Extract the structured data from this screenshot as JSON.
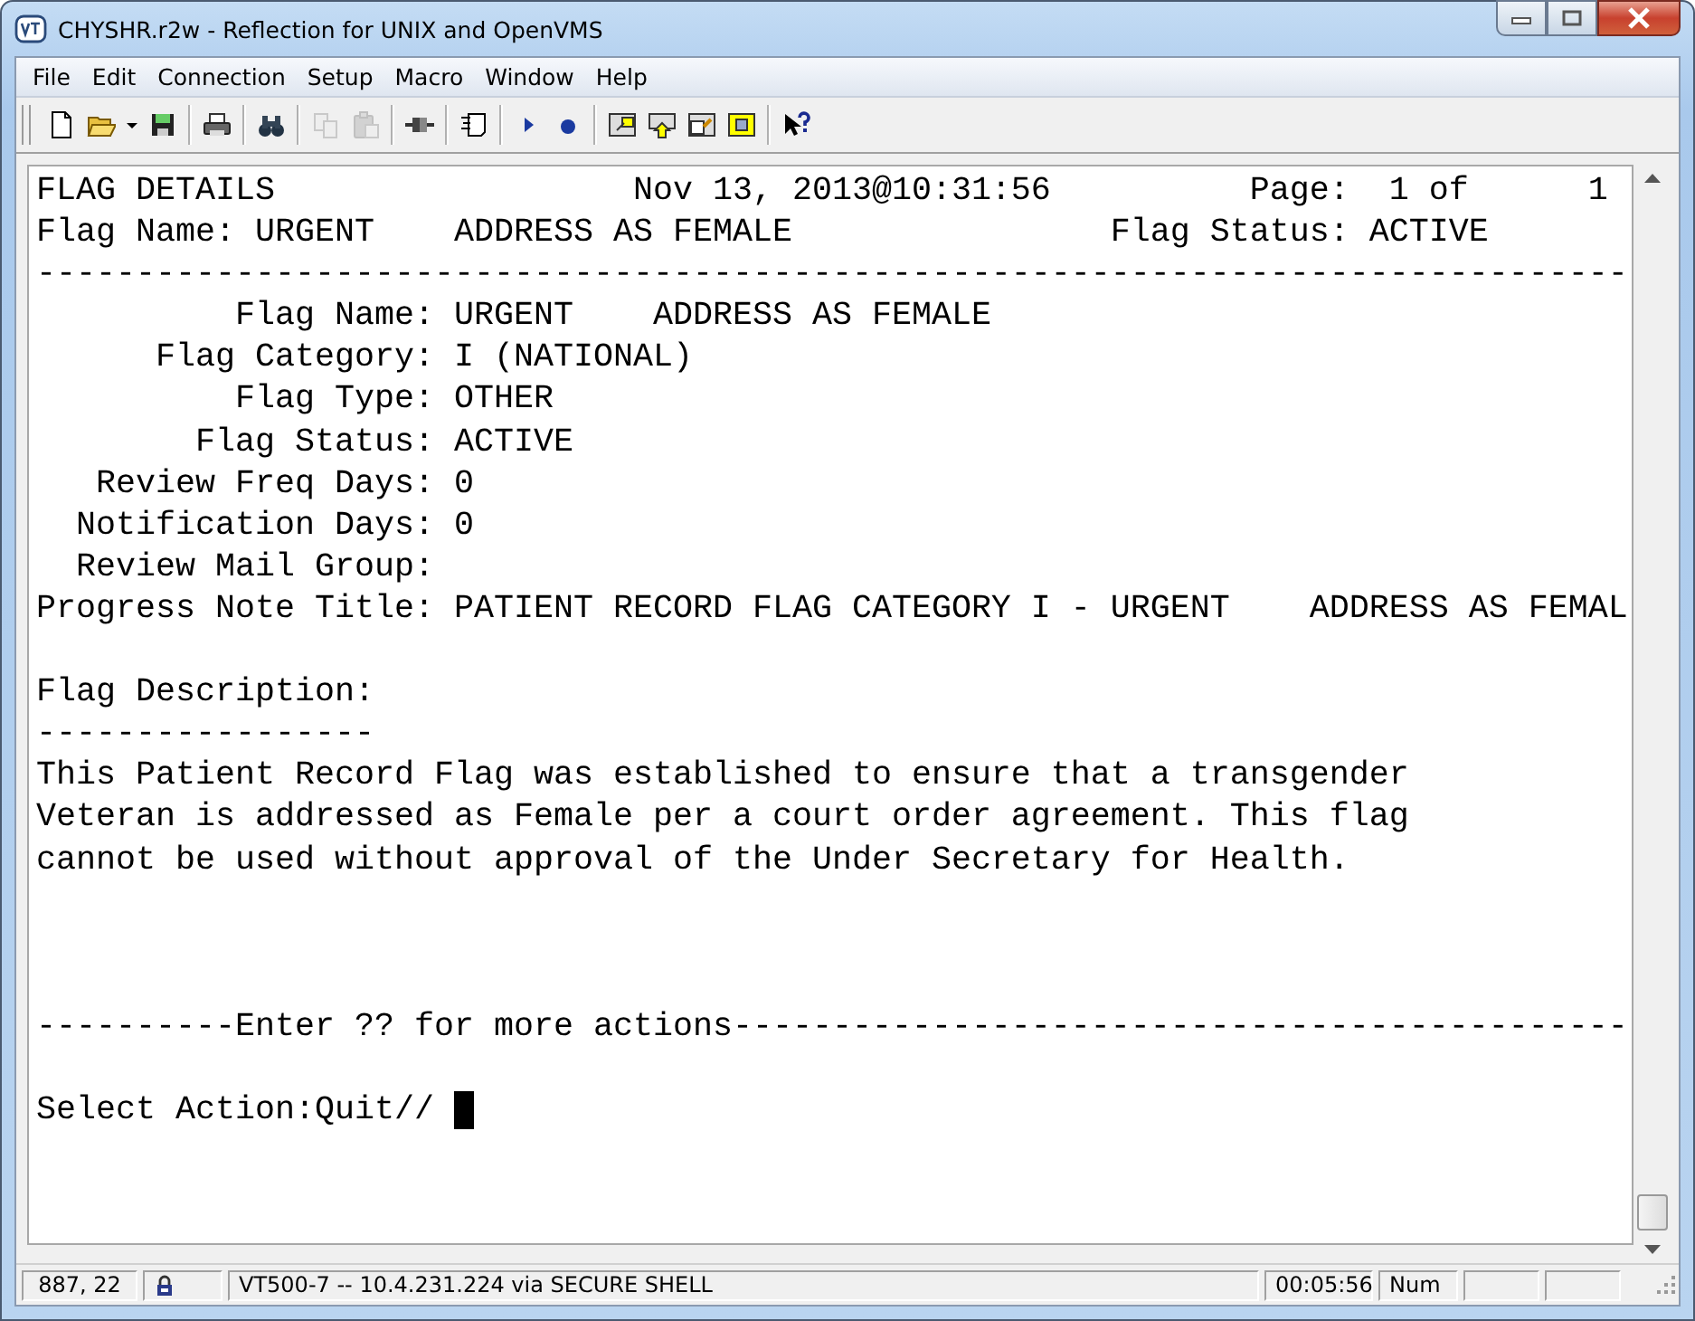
{
  "window": {
    "title": "CHYSHR.r2w - Reflection for UNIX and OpenVMS"
  },
  "menu": [
    "File",
    "Edit",
    "Connection",
    "Setup",
    "Macro",
    "Window",
    "Help"
  ],
  "toolbar": [
    {
      "kind": "new",
      "disabled": false
    },
    {
      "kind": "open",
      "disabled": false
    },
    {
      "kind": "caret",
      "disabled": false
    },
    {
      "kind": "save",
      "disabled": false
    },
    {
      "kind": "sep"
    },
    {
      "kind": "print",
      "disabled": false
    },
    {
      "kind": "sep"
    },
    {
      "kind": "find",
      "disabled": false
    },
    {
      "kind": "sep"
    },
    {
      "kind": "copy",
      "disabled": true
    },
    {
      "kind": "paste",
      "disabled": true
    },
    {
      "kind": "sep"
    },
    {
      "kind": "plug",
      "disabled": false
    },
    {
      "kind": "sep"
    },
    {
      "kind": "script",
      "disabled": false
    },
    {
      "kind": "sep"
    },
    {
      "kind": "play",
      "disabled": false
    },
    {
      "kind": "record",
      "disabled": false
    },
    {
      "kind": "sep"
    },
    {
      "kind": "screen-in",
      "disabled": false
    },
    {
      "kind": "screen-up",
      "disabled": false
    },
    {
      "kind": "screen-out",
      "disabled": false
    },
    {
      "kind": "screen-full",
      "disabled": false
    },
    {
      "kind": "sep"
    },
    {
      "kind": "help",
      "disabled": false
    }
  ],
  "terminal": {
    "lines": [
      {
        "kind": "text",
        "text": "FLAG DETAILS                  Nov 13, 2013@10:31:56          Page:  1 of      1"
      },
      {
        "kind": "text",
        "text": "Flag Name: URGENT    ADDRESS AS FEMALE                Flag Status: ACTIVE"
      },
      {
        "kind": "text",
        "text": "--------------------------------------------------------------------------------"
      },
      {
        "kind": "text",
        "text": "          Flag Name: URGENT    ADDRESS AS FEMALE"
      },
      {
        "kind": "text",
        "text": "      Flag Category: I (NATIONAL)"
      },
      {
        "kind": "text",
        "text": "          Flag Type: OTHER"
      },
      {
        "kind": "text",
        "text": "        Flag Status: ACTIVE"
      },
      {
        "kind": "text",
        "text": "   Review Freq Days: 0"
      },
      {
        "kind": "text",
        "text": "  Notification Days: 0"
      },
      {
        "kind": "text",
        "text": "  Review Mail Group:"
      },
      {
        "kind": "text",
        "text": "Progress Note Title: PATIENT RECORD FLAG CATEGORY I - URGENT    ADDRESS AS FEMAL"
      },
      {
        "kind": "blank"
      },
      {
        "kind": "text",
        "text": "Flag Description:"
      },
      {
        "kind": "text",
        "text": "-----------------"
      },
      {
        "kind": "text",
        "text": "This Patient Record Flag was established to ensure that a transgender"
      },
      {
        "kind": "text",
        "text": "Veteran is addressed as Female per a court order agreement. This flag"
      },
      {
        "kind": "text",
        "text": "cannot be used without approval of the Under Secretary for Health."
      },
      {
        "kind": "blank"
      },
      {
        "kind": "blank"
      },
      {
        "kind": "blank"
      },
      {
        "kind": "text",
        "text": "----------Enter ?? for more actions---------------------------------------------"
      },
      {
        "kind": "blank"
      },
      {
        "kind": "prompt",
        "text": "Select Action:Quit// ",
        "cursor": true
      }
    ]
  },
  "status_bar": {
    "position": "887, 22",
    "locked": true,
    "connection": "VT500-7 -- 10.4.231.224 via SECURE SHELL",
    "time": "00:05:56",
    "num_lock": "Num"
  }
}
